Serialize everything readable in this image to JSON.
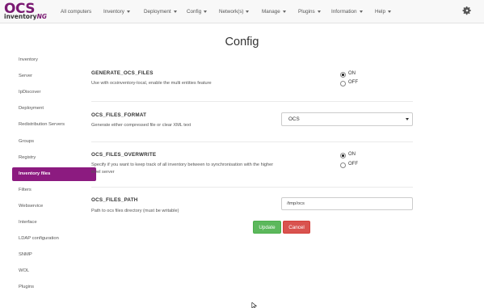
{
  "brand": {
    "line1": "OCS",
    "line2": "inventory",
    "line2_suffix": "NG"
  },
  "nav": [
    {
      "label": "All computers",
      "dropdown": false
    },
    {
      "label": "Inventory",
      "dropdown": true
    },
    {
      "label": "Deployment",
      "dropdown": true
    },
    {
      "label": "Config",
      "dropdown": true
    },
    {
      "label": "Network(s)",
      "dropdown": true
    },
    {
      "label": "Manage",
      "dropdown": true
    },
    {
      "label": "Plugins",
      "dropdown": true
    },
    {
      "label": "Information",
      "dropdown": true
    },
    {
      "label": "Help",
      "dropdown": true
    }
  ],
  "title": "Config",
  "sidebar": [
    {
      "label": "Inventory"
    },
    {
      "label": "Server"
    },
    {
      "label": "IpDiscover"
    },
    {
      "label": "Deployment"
    },
    {
      "label": "Redistribution Servers"
    },
    {
      "label": "Groups"
    },
    {
      "label": "Registry"
    },
    {
      "label": "Inventory files",
      "active": true
    },
    {
      "label": "Filters"
    },
    {
      "label": "Webservice"
    },
    {
      "label": "Interface"
    },
    {
      "label": "LDAP configuration"
    },
    {
      "label": "SNMP"
    },
    {
      "label": "WOL"
    },
    {
      "label": "Plugins"
    }
  ],
  "settings": {
    "generate": {
      "name": "GENERATE_OCS_FILES",
      "desc": "Use with ocsinventory-local, enable the multi entities feature",
      "on_label": "ON",
      "off_label": "OFF",
      "value": "ON"
    },
    "format": {
      "name": "OCS_FILES_FORMAT",
      "desc": "Generate either compressed file or clear XML text",
      "selected": "OCS"
    },
    "overwrite": {
      "name": "OCS_FILES_OVERWRITE",
      "desc": "Specify if you want to keep track of all inventory between to synchronisation with the higher level server",
      "on_label": "ON",
      "off_label": "OFF",
      "value": "ON"
    },
    "path": {
      "name": "OCS_FILES_PATH",
      "desc": "Path to ocs files directory (must be writable)",
      "value": "/tmp/ocs"
    }
  },
  "buttons": {
    "update": "Update",
    "cancel": "Cancel"
  },
  "colors": {
    "brand": "#8c1b80",
    "update": "#5cb85c",
    "cancel": "#d9534f"
  }
}
